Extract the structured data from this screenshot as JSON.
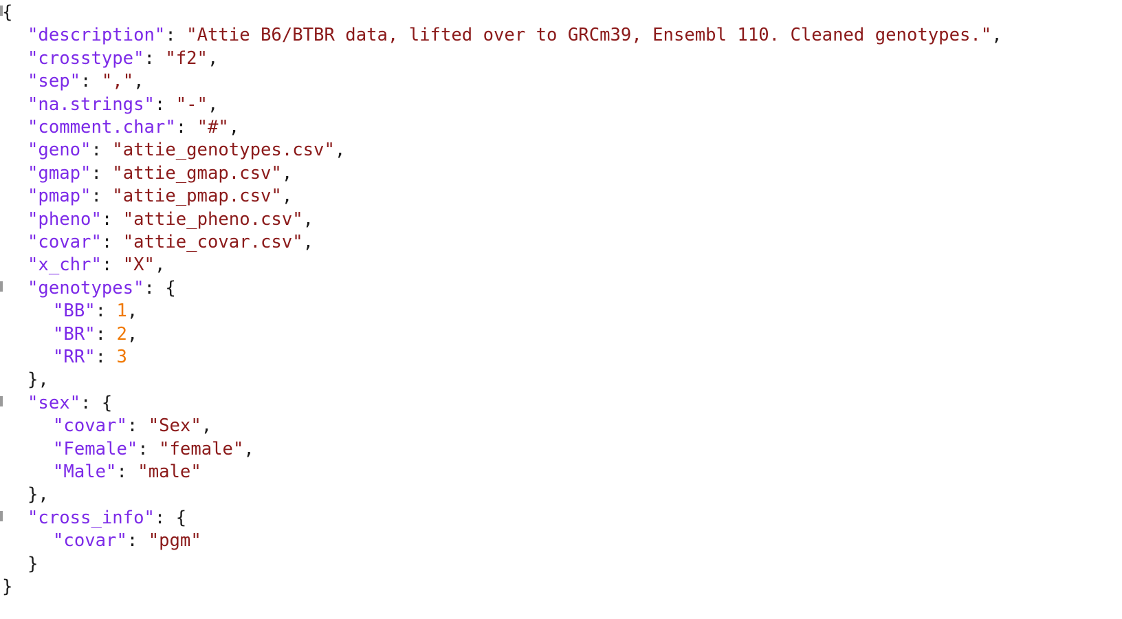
{
  "editor": {
    "language": "json",
    "background_color": "#ffffff",
    "key_color": "#7c2ae8",
    "string_color": "#8b1a1a",
    "number_color": "#f07800",
    "punctuation_color": "#1a1a1a"
  },
  "document": {
    "open_brace": "{",
    "close_brace": "}",
    "lines": [
      {
        "indent": 0,
        "type": "open-brace",
        "text": "{"
      },
      {
        "indent": 1,
        "type": "key-string",
        "key": "description",
        "value": "Attie B6/BTBR data, lifted over to GRCm39, Ensembl 110. Cleaned genotypes.",
        "comma": true
      },
      {
        "indent": 1,
        "type": "key-string",
        "key": "crosstype",
        "value": "f2",
        "comma": true
      },
      {
        "indent": 1,
        "type": "key-string",
        "key": "sep",
        "value": ",",
        "comma": true
      },
      {
        "indent": 1,
        "type": "key-string",
        "key": "na.strings",
        "value": "-",
        "comma": true
      },
      {
        "indent": 1,
        "type": "key-string",
        "key": "comment.char",
        "value": "#",
        "comma": true
      },
      {
        "indent": 1,
        "type": "key-string",
        "key": "geno",
        "value": "attie_genotypes.csv",
        "comma": true
      },
      {
        "indent": 1,
        "type": "key-string",
        "key": "gmap",
        "value": "attie_gmap.csv",
        "comma": true
      },
      {
        "indent": 1,
        "type": "key-string",
        "key": "pmap",
        "value": "attie_pmap.csv",
        "comma": true
      },
      {
        "indent": 1,
        "type": "key-string",
        "key": "pheno",
        "value": "attie_pheno.csv",
        "comma": true
      },
      {
        "indent": 1,
        "type": "key-string",
        "key": "covar",
        "value": "attie_covar.csv",
        "comma": true
      },
      {
        "indent": 1,
        "type": "key-string",
        "key": "x_chr",
        "value": "X",
        "comma": true
      },
      {
        "indent": 1,
        "type": "key-object",
        "key": "genotypes",
        "comma": false
      },
      {
        "indent": 2,
        "type": "key-number",
        "key": "BB",
        "value": "1",
        "comma": true
      },
      {
        "indent": 2,
        "type": "key-number",
        "key": "BR",
        "value": "2",
        "comma": true
      },
      {
        "indent": 2,
        "type": "key-number",
        "key": "RR",
        "value": "3",
        "comma": false
      },
      {
        "indent": 1,
        "type": "close-brace",
        "text": "}",
        "comma": true
      },
      {
        "indent": 1,
        "type": "key-object",
        "key": "sex",
        "comma": false
      },
      {
        "indent": 2,
        "type": "key-string",
        "key": "covar",
        "value": "Sex",
        "comma": true
      },
      {
        "indent": 2,
        "type": "key-string",
        "key": "Female",
        "value": "female",
        "comma": true
      },
      {
        "indent": 2,
        "type": "key-string",
        "key": "Male",
        "value": "male",
        "comma": false
      },
      {
        "indent": 1,
        "type": "close-brace",
        "text": "}",
        "comma": true
      },
      {
        "indent": 1,
        "type": "key-object",
        "key": "cross_info",
        "comma": false
      },
      {
        "indent": 2,
        "type": "key-string",
        "key": "covar",
        "value": "pgm",
        "comma": false
      },
      {
        "indent": 1,
        "type": "close-brace",
        "text": "}",
        "comma": false
      },
      {
        "indent": 0,
        "type": "close-brace",
        "text": "}",
        "comma": false
      }
    ]
  },
  "fold_markers": [
    {
      "line_index": 0
    },
    {
      "line_index": 12
    },
    {
      "line_index": 17
    },
    {
      "line_index": 22
    }
  ]
}
